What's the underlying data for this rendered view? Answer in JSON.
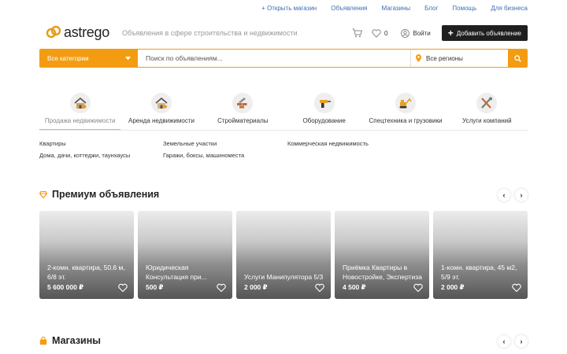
{
  "top_links": [
    "+ Открыть магазин",
    "Объявления",
    "Магазины",
    "Блог",
    "Помощь",
    "Для бизнеса"
  ],
  "header": {
    "logo_text": "astrego",
    "tagline": "Объявления в сфере строительства и недвижимости",
    "favorites_count": "0",
    "login_label": "Войти",
    "add_button_label": "Добавить объявление"
  },
  "search": {
    "category_label": "Все категории",
    "placeholder": "Поиск по объявлениям...",
    "region_label": "Все регионы"
  },
  "categories": [
    {
      "label": "Продажа недвижимости",
      "icon": "house-sale-icon"
    },
    {
      "label": "Аренда недвижимости",
      "icon": "house-rent-icon"
    },
    {
      "label": "Стройматериалы",
      "icon": "bricks-icon"
    },
    {
      "label": "Оборудование",
      "icon": "drill-icon"
    },
    {
      "label": "Спецтехника и грузовики",
      "icon": "excavator-icon"
    },
    {
      "label": "Услуги компаний",
      "icon": "tools-icon"
    }
  ],
  "subcategories": [
    "Квартиры",
    "Земельные участки",
    "Коммерческая недвижимость",
    "Дома, дачи, коттеджи, таунхаусы",
    "Гаражи, боксы, машиноместа"
  ],
  "premium": {
    "title": "Премиум объявления",
    "cards": [
      {
        "title": "2-комн. квартира, 50.6 м, 6/8 эт.",
        "price": "5 600 000 ₽"
      },
      {
        "title": "Юридическая Консультация при...",
        "price": "500 ₽"
      },
      {
        "title": "Услуги Манипулятора 5/3",
        "price": "2 000 ₽"
      },
      {
        "title": "Приёмка Квартиры в Новостройке, Экспертиза",
        "price": "4 500 ₽"
      },
      {
        "title": "1-комн. квартира, 45 м2, 5/9 эт.",
        "price": "2 000 ₽"
      }
    ]
  },
  "shops": {
    "title": "Магазины"
  },
  "colors": {
    "accent": "#f39c12",
    "link": "#3b6fb6",
    "dark_button": "#1f1f1f"
  }
}
